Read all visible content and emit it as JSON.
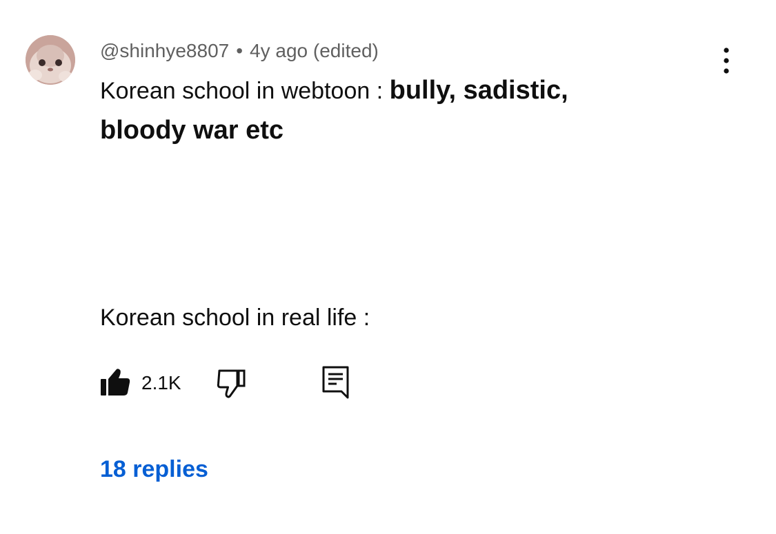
{
  "comment": {
    "author": "@shinhye8807",
    "separator": "•",
    "timestamp": "4y ago",
    "edited": "(edited)",
    "text": {
      "line1_prefix": "Korean school in webtoon : ",
      "line1_bold": "bully, sadistic,",
      "line2_bold": "bloody war etc",
      "line3": "Korean school in real life :"
    },
    "like_count": "2.1K",
    "replies_label": "18 replies"
  },
  "icons": {
    "avatar": "cat-avatar",
    "more": "vertical-ellipsis-icon",
    "like": "thumbs-up-filled-icon",
    "dislike": "thumbs-down-outline-icon",
    "reply": "comment-reply-icon"
  },
  "colors": {
    "text": "#0f0f0f",
    "secondary_text": "#606060",
    "link": "#065fd4"
  }
}
